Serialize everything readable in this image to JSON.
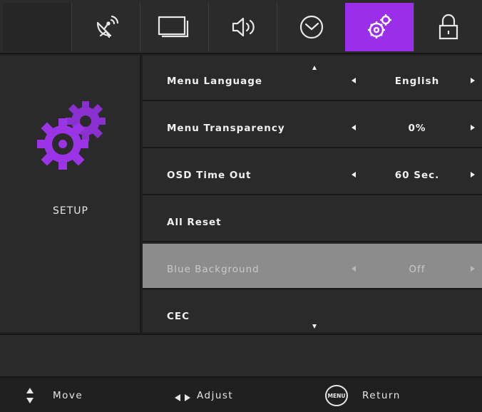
{
  "tabs": [
    {
      "icon": "satellite-dish-icon"
    },
    {
      "icon": "picture-icon"
    },
    {
      "icon": "speaker-sound-icon"
    },
    {
      "icon": "clock-icon"
    },
    {
      "icon": "gears-icon",
      "active": true
    },
    {
      "icon": "lock-icon"
    }
  ],
  "accent_color": "#9b2ee8",
  "section": {
    "title": "SETUP",
    "icon": "setup-gears-icon"
  },
  "menu": [
    {
      "label": "Menu Language",
      "value": "English"
    },
    {
      "label": "Menu Transparency",
      "value": "0%"
    },
    {
      "label": "OSD Time Out",
      "value": "60 Sec."
    },
    {
      "label": "All Reset",
      "value": ""
    },
    {
      "label": "Blue Background",
      "value": "Off",
      "selected": true
    },
    {
      "label": "CEC",
      "value": ""
    }
  ],
  "footer": {
    "move": "Move",
    "adjust": "Adjust",
    "menu_badge": "MENU",
    "return": "Return"
  }
}
